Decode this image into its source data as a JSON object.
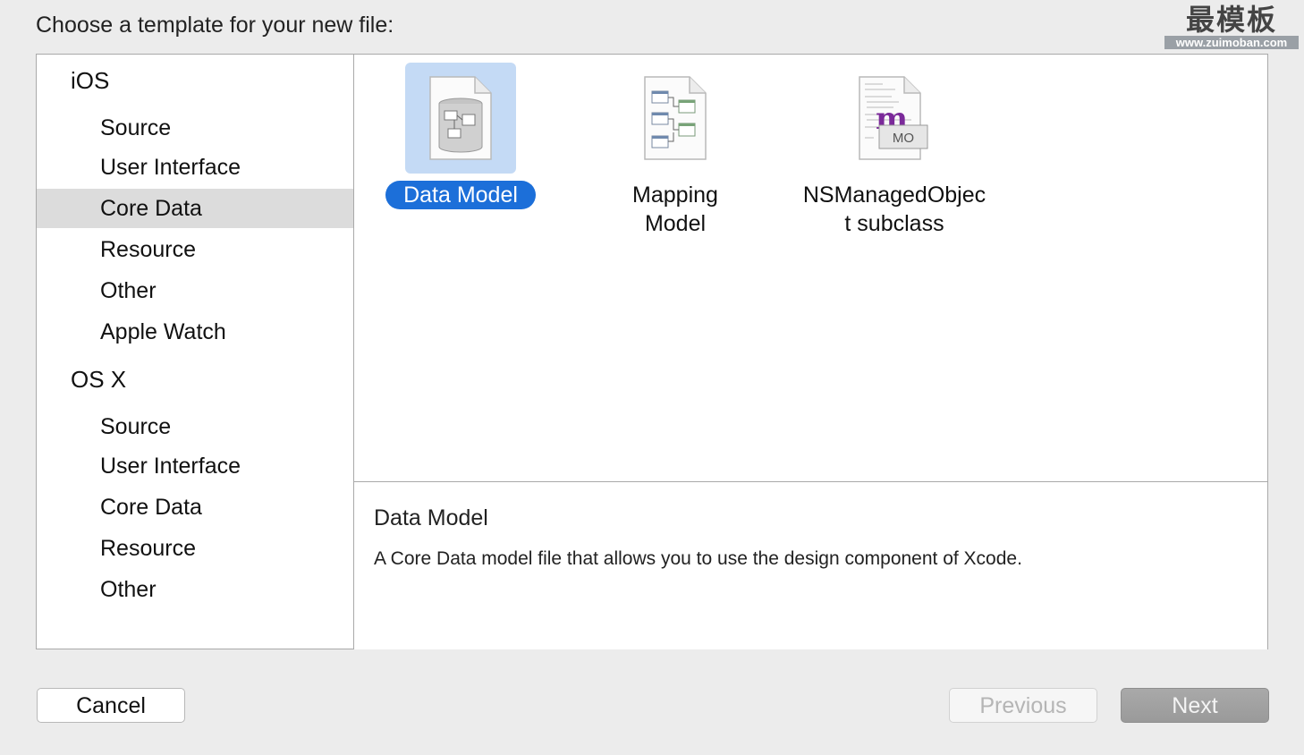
{
  "prompt": "Choose a template for your new file:",
  "watermark": {
    "cn": "最模板",
    "url": "www.zuimoban.com"
  },
  "sidebar": {
    "groups": [
      {
        "title": "iOS",
        "items": [
          {
            "label": "Source",
            "selected": false
          },
          {
            "label": "User Interface",
            "selected": false
          },
          {
            "label": "Core Data",
            "selected": true
          },
          {
            "label": "Resource",
            "selected": false
          },
          {
            "label": "Other",
            "selected": false
          },
          {
            "label": "Apple Watch",
            "selected": false
          }
        ]
      },
      {
        "title": "OS X",
        "items": [
          {
            "label": "Source",
            "selected": false
          },
          {
            "label": "User Interface",
            "selected": false
          },
          {
            "label": "Core Data",
            "selected": false
          },
          {
            "label": "Resource",
            "selected": false
          },
          {
            "label": "Other",
            "selected": false
          }
        ]
      }
    ]
  },
  "templates": [
    {
      "label": "Data Model",
      "icon": "data-model-icon",
      "selected": true
    },
    {
      "label": "Mapping Model",
      "icon": "mapping-model-icon",
      "selected": false
    },
    {
      "label": "NSManagedObject subclass",
      "icon": "managed-object-icon",
      "badge": "MO",
      "selected": false
    }
  ],
  "description": {
    "title": "Data Model",
    "text": "A Core Data model file that allows you to use the design component of Xcode."
  },
  "buttons": {
    "cancel": "Cancel",
    "previous": "Previous",
    "next": "Next"
  },
  "colors": {
    "selection_blue": "#1c6fd9",
    "icon_selection_bg": "#c4daf5",
    "sidebar_selection": "#dcdcdc",
    "mo_letter": "#7b2a9a"
  }
}
